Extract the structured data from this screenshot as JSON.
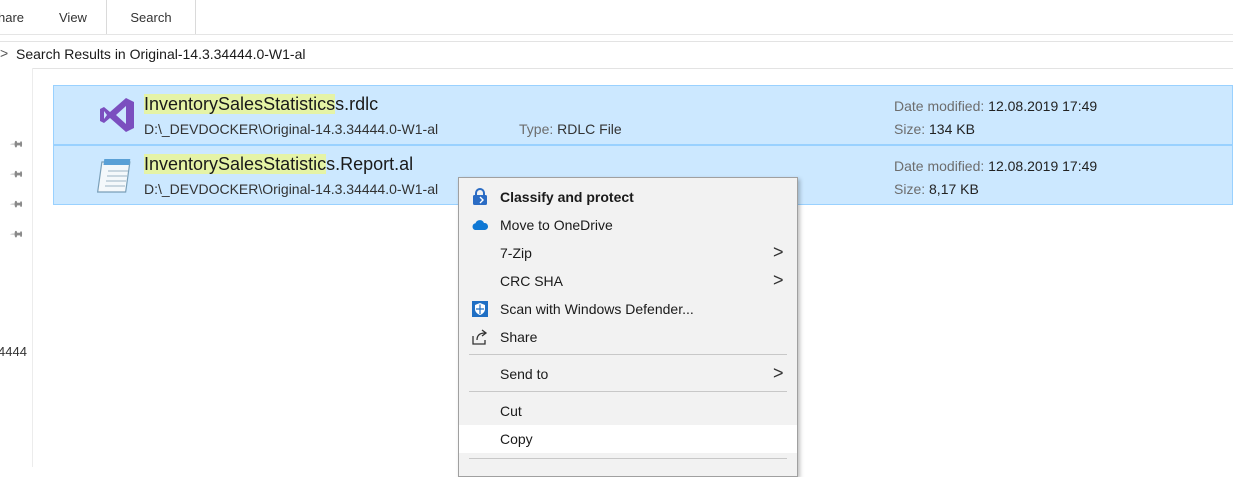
{
  "ribbon": {
    "tabs": [
      "hare",
      "View",
      "Search"
    ]
  },
  "address": {
    "chevron": ">",
    "text": "Search Results in Original-14.3.34444.0-W1-al"
  },
  "nav": {
    "partial_text": "4444"
  },
  "results": [
    {
      "name_highlight": "InventorySalesStatistics",
      "name_rest": "s.rdlc",
      "path": "D:\\_DEVDOCKER\\Original-14.3.34444.0-W1-al",
      "type_label": "Type:",
      "type_value": "RDLC File",
      "date_label": "Date modified:",
      "date_value": "12.08.2019 17:49",
      "size_label": "Size:",
      "size_value": "134 KB",
      "icon": "visual-studio-icon"
    },
    {
      "name_highlight": "InventorySalesStatistic",
      "name_rest": "s.Report.al",
      "path": "D:\\_DEVDOCKER\\Original-14.3.34444.0-W1-al",
      "date_label": "Date modified:",
      "date_value": "12.08.2019 17:49",
      "size_label": "Size:",
      "size_value": "8,17 KB",
      "icon": "notepad-icon"
    }
  ],
  "context_menu": {
    "items": [
      {
        "label": "Classify and protect",
        "icon": "classify-lock-icon",
        "bold": true
      },
      {
        "label": "Move to OneDrive",
        "icon": "onedrive-cloud-icon"
      },
      {
        "label": "7-Zip",
        "submenu": true
      },
      {
        "label": "CRC SHA",
        "submenu": true
      },
      {
        "label": "Scan with Windows Defender...",
        "icon": "defender-shield-icon"
      },
      {
        "label": "Share",
        "icon": "share-icon"
      },
      {
        "label": "Send to",
        "submenu": true
      },
      {
        "label": "Cut"
      },
      {
        "label": "Copy"
      }
    ],
    "arrow_glyph": ">"
  }
}
